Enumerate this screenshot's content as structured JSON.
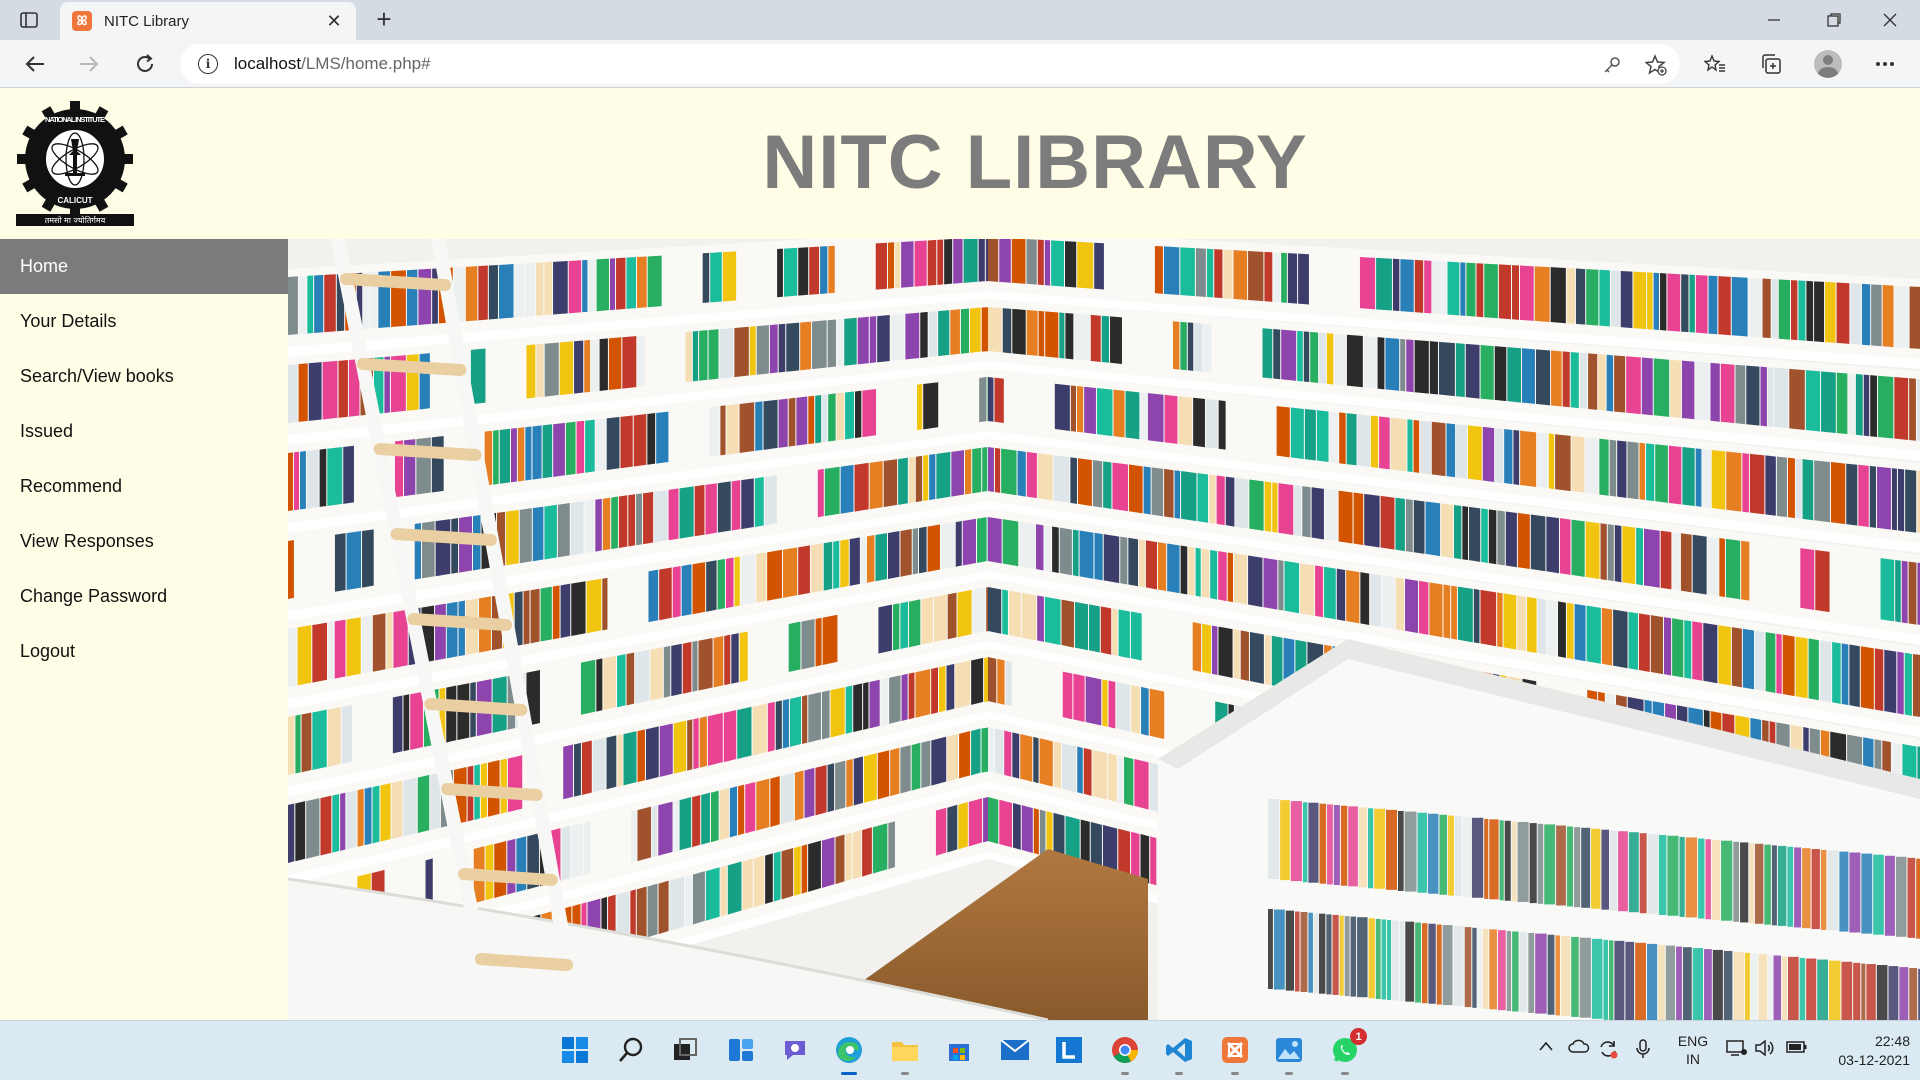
{
  "browser": {
    "tab_title": "NITC Library",
    "tab_close": "✕",
    "new_tab": "+",
    "url_host": "localhost",
    "url_path": "/LMS/home.php#",
    "icons": [
      "back-arrow",
      "forward-arrow",
      "refresh",
      "site-info",
      "password-key",
      "add-favorite",
      "favorites",
      "collections",
      "profile",
      "more"
    ]
  },
  "header": {
    "title": "NITC LIBRARY",
    "logo_text_top": "NATIONAL INSTITUTE OF TECHNOLOGY",
    "logo_text_bottom": "CALICUT",
    "logo_motto": "तमसो मा ज्योतिर्गमय"
  },
  "sidebar": {
    "items": [
      {
        "label": "Home",
        "active": true
      },
      {
        "label": "Your Details",
        "active": false
      },
      {
        "label": "Search/View books",
        "active": false
      },
      {
        "label": "Issued",
        "active": false
      },
      {
        "label": "Recommend",
        "active": false
      },
      {
        "label": "View Responses",
        "active": false
      },
      {
        "label": "Change Password",
        "active": false
      },
      {
        "label": "Logout",
        "active": false
      }
    ]
  },
  "hero": {
    "image": "library bookshelves photo"
  },
  "taskbar": {
    "apps": [
      "start",
      "search",
      "task-view",
      "widgets",
      "chat",
      "edge",
      "file-explorer",
      "store",
      "mail",
      "l-app",
      "chrome",
      "vscode",
      "xampp",
      "photos",
      "whatsapp"
    ],
    "whatsapp_badge": "1",
    "lang_line1": "ENG",
    "lang_line2": "IN",
    "time": "22:48",
    "date": "03-12-2021"
  },
  "colors": {
    "page_bg": "#fffde6",
    "active_menu_bg": "#7b7b7b",
    "title_color": "#7c7c7c",
    "taskbar_bg": "#dbeaf2"
  }
}
